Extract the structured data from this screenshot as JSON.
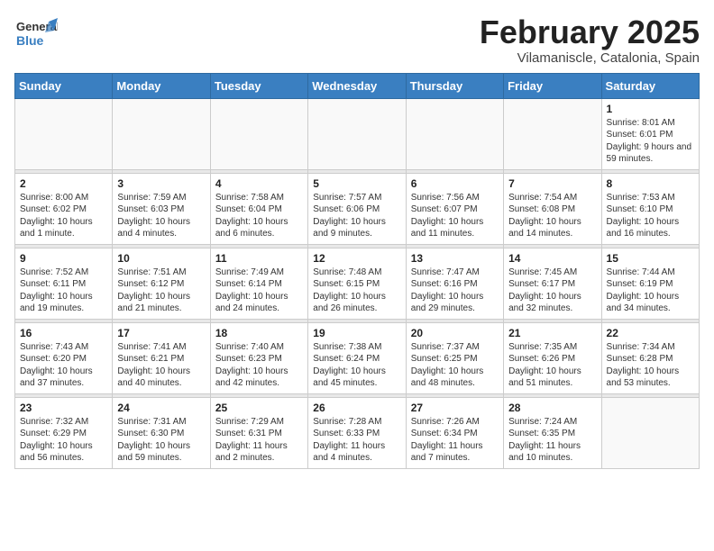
{
  "header": {
    "logo_text_general": "General",
    "logo_text_blue": "Blue",
    "month_title": "February 2025",
    "location": "Vilamaniscle, Catalonia, Spain"
  },
  "weekdays": [
    "Sunday",
    "Monday",
    "Tuesday",
    "Wednesday",
    "Thursday",
    "Friday",
    "Saturday"
  ],
  "weeks": [
    [
      {
        "day": "",
        "info": ""
      },
      {
        "day": "",
        "info": ""
      },
      {
        "day": "",
        "info": ""
      },
      {
        "day": "",
        "info": ""
      },
      {
        "day": "",
        "info": ""
      },
      {
        "day": "",
        "info": ""
      },
      {
        "day": "1",
        "info": "Sunrise: 8:01 AM\nSunset: 6:01 PM\nDaylight: 9 hours and 59 minutes."
      }
    ],
    [
      {
        "day": "2",
        "info": "Sunrise: 8:00 AM\nSunset: 6:02 PM\nDaylight: 10 hours and 1 minute."
      },
      {
        "day": "3",
        "info": "Sunrise: 7:59 AM\nSunset: 6:03 PM\nDaylight: 10 hours and 4 minutes."
      },
      {
        "day": "4",
        "info": "Sunrise: 7:58 AM\nSunset: 6:04 PM\nDaylight: 10 hours and 6 minutes."
      },
      {
        "day": "5",
        "info": "Sunrise: 7:57 AM\nSunset: 6:06 PM\nDaylight: 10 hours and 9 minutes."
      },
      {
        "day": "6",
        "info": "Sunrise: 7:56 AM\nSunset: 6:07 PM\nDaylight: 10 hours and 11 minutes."
      },
      {
        "day": "7",
        "info": "Sunrise: 7:54 AM\nSunset: 6:08 PM\nDaylight: 10 hours and 14 minutes."
      },
      {
        "day": "8",
        "info": "Sunrise: 7:53 AM\nSunset: 6:10 PM\nDaylight: 10 hours and 16 minutes."
      }
    ],
    [
      {
        "day": "9",
        "info": "Sunrise: 7:52 AM\nSunset: 6:11 PM\nDaylight: 10 hours and 19 minutes."
      },
      {
        "day": "10",
        "info": "Sunrise: 7:51 AM\nSunset: 6:12 PM\nDaylight: 10 hours and 21 minutes."
      },
      {
        "day": "11",
        "info": "Sunrise: 7:49 AM\nSunset: 6:14 PM\nDaylight: 10 hours and 24 minutes."
      },
      {
        "day": "12",
        "info": "Sunrise: 7:48 AM\nSunset: 6:15 PM\nDaylight: 10 hours and 26 minutes."
      },
      {
        "day": "13",
        "info": "Sunrise: 7:47 AM\nSunset: 6:16 PM\nDaylight: 10 hours and 29 minutes."
      },
      {
        "day": "14",
        "info": "Sunrise: 7:45 AM\nSunset: 6:17 PM\nDaylight: 10 hours and 32 minutes."
      },
      {
        "day": "15",
        "info": "Sunrise: 7:44 AM\nSunset: 6:19 PM\nDaylight: 10 hours and 34 minutes."
      }
    ],
    [
      {
        "day": "16",
        "info": "Sunrise: 7:43 AM\nSunset: 6:20 PM\nDaylight: 10 hours and 37 minutes."
      },
      {
        "day": "17",
        "info": "Sunrise: 7:41 AM\nSunset: 6:21 PM\nDaylight: 10 hours and 40 minutes."
      },
      {
        "day": "18",
        "info": "Sunrise: 7:40 AM\nSunset: 6:23 PM\nDaylight: 10 hours and 42 minutes."
      },
      {
        "day": "19",
        "info": "Sunrise: 7:38 AM\nSunset: 6:24 PM\nDaylight: 10 hours and 45 minutes."
      },
      {
        "day": "20",
        "info": "Sunrise: 7:37 AM\nSunset: 6:25 PM\nDaylight: 10 hours and 48 minutes."
      },
      {
        "day": "21",
        "info": "Sunrise: 7:35 AM\nSunset: 6:26 PM\nDaylight: 10 hours and 51 minutes."
      },
      {
        "day": "22",
        "info": "Sunrise: 7:34 AM\nSunset: 6:28 PM\nDaylight: 10 hours and 53 minutes."
      }
    ],
    [
      {
        "day": "23",
        "info": "Sunrise: 7:32 AM\nSunset: 6:29 PM\nDaylight: 10 hours and 56 minutes."
      },
      {
        "day": "24",
        "info": "Sunrise: 7:31 AM\nSunset: 6:30 PM\nDaylight: 10 hours and 59 minutes."
      },
      {
        "day": "25",
        "info": "Sunrise: 7:29 AM\nSunset: 6:31 PM\nDaylight: 11 hours and 2 minutes."
      },
      {
        "day": "26",
        "info": "Sunrise: 7:28 AM\nSunset: 6:33 PM\nDaylight: 11 hours and 4 minutes."
      },
      {
        "day": "27",
        "info": "Sunrise: 7:26 AM\nSunset: 6:34 PM\nDaylight: 11 hours and 7 minutes."
      },
      {
        "day": "28",
        "info": "Sunrise: 7:24 AM\nSunset: 6:35 PM\nDaylight: 11 hours and 10 minutes."
      },
      {
        "day": "",
        "info": ""
      }
    ]
  ]
}
